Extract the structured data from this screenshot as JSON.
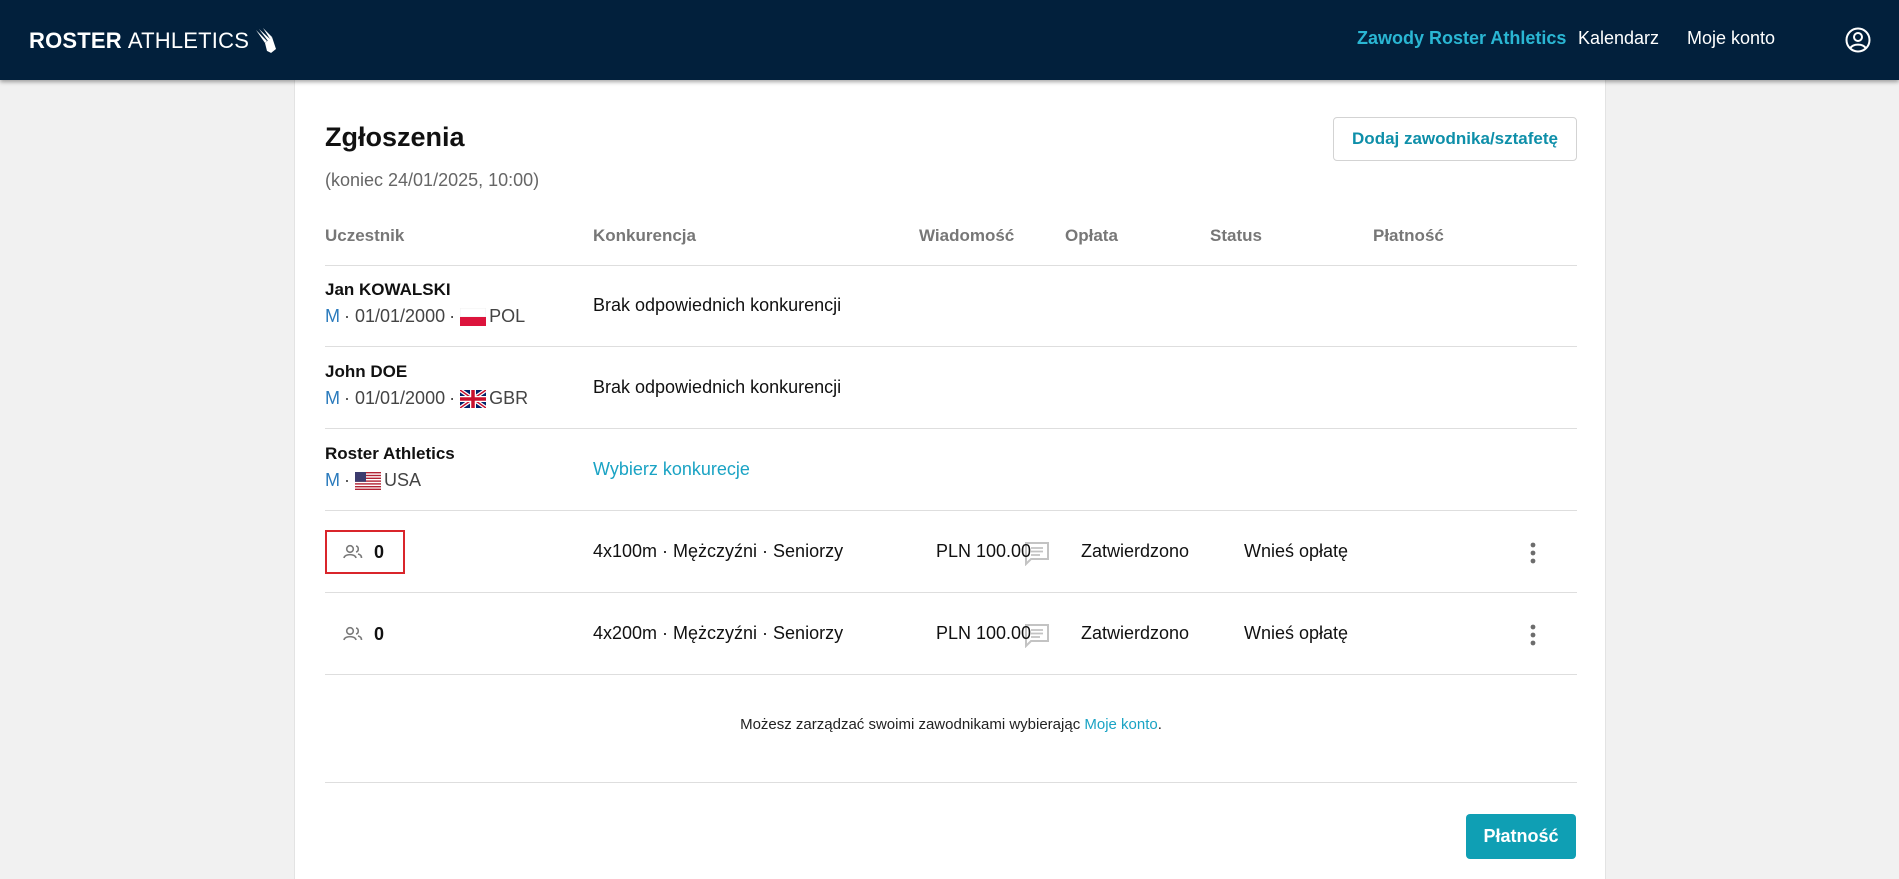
{
  "header": {
    "brand_bold": "ROSTER",
    "brand_light": "ATHLETICS",
    "nav": [
      {
        "label": "Zawody Roster Athletics",
        "active": true
      },
      {
        "label": "Kalendarz",
        "active": false
      },
      {
        "label": "Moje konto",
        "active": false
      }
    ],
    "colors": {
      "bar": "#02203c",
      "accent": "#2ab6d3"
    }
  },
  "page": {
    "title": "Zgłoszenia",
    "deadline": "(koniec 24/01/2025, 10:00)",
    "add_button": "Dodaj zawodnika/sztafetę"
  },
  "table": {
    "columns": [
      "Uczestnik",
      "Konkurencja",
      "Wiadomość",
      "Opłata",
      "Status",
      "Płatność"
    ],
    "athletes": [
      {
        "name": "Jan KOWALSKI",
        "gender": "M",
        "sep1": "·",
        "dob": "01/01/2000",
        "sep2": "·",
        "flag": "poland-flag",
        "country": "POL",
        "event": "Brak odpowiednich konkurencji"
      },
      {
        "name": "John DOE",
        "gender": "M",
        "sep1": "·",
        "dob": "01/01/2000",
        "sep2": "·",
        "flag": "uk-flag",
        "country": "GBR",
        "event": "Brak odpowiednich konkurencji"
      },
      {
        "name": "Roster Athletics",
        "gender": "M",
        "sep1": "·",
        "flag": "usa-flag",
        "country": "USA",
        "event_link": "Wybierz konkurecje"
      }
    ],
    "relays": [
      {
        "members": "0",
        "event": "4x100m · Mężczyźni · Seniorzy",
        "fee": "PLN 100.00",
        "status": "Zatwierdzono",
        "payment": "Wnieś opłatę",
        "highlighted": true
      },
      {
        "members": "0",
        "event": "4x200m · Mężczyźni · Seniorzy",
        "fee": "PLN 100.00",
        "status": "Zatwierdzono",
        "payment": "Wnieś opłatę",
        "highlighted": false
      }
    ]
  },
  "footer": {
    "note_text": "Możesz zarządzać swoimi zawodnikami wybierając",
    "note_link": "Moje konto",
    "note_end": ".",
    "pay_button": "Płatność"
  },
  "icons": {
    "brand": "winged-shoe-icon",
    "user": "user-circle-icon",
    "team": "team-icon",
    "message": "message-icon",
    "more": "more-vertical-icon"
  }
}
